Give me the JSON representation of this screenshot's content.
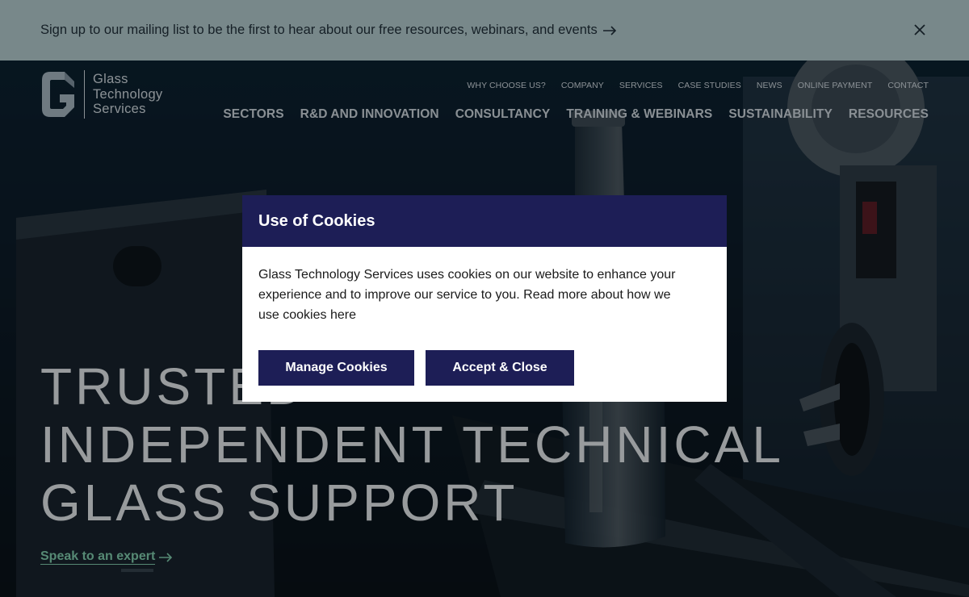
{
  "banner": {
    "text": "Sign up to our mailing list to be the first to hear about our free resources, webinars, and events",
    "arrow_icon": "arrow-right-icon",
    "close_icon": "close-icon"
  },
  "logo": {
    "lines": [
      "Glass",
      "Technology",
      "Services"
    ]
  },
  "utility_nav": [
    {
      "label": "WHY CHOOSE US?"
    },
    {
      "label": "COMPANY"
    },
    {
      "label": "SERVICES"
    },
    {
      "label": "CASE STUDIES"
    },
    {
      "label": "NEWS"
    },
    {
      "label": "ONLINE PAYMENT"
    },
    {
      "label": "CONTACT"
    }
  ],
  "main_nav": [
    {
      "label": "SECTORS"
    },
    {
      "label": "R&D AND INNOVATION"
    },
    {
      "label": "CONSULTANCY"
    },
    {
      "label": "TRAINING & WEBINARS"
    },
    {
      "label": "SUSTAINABILITY"
    },
    {
      "label": "RESOURCES"
    }
  ],
  "hero": {
    "headline_lines": [
      "TRUSTED",
      "INDEPENDENT TECHNICAL",
      "GLASS SUPPORT"
    ],
    "cta_label": "Speak to an expert"
  },
  "cookie_dialog": {
    "title": "Use of Cookies",
    "body": "Glass Technology Services uses cookies on our website to enhance your experience and to improve our service to you. Read more about how we use cookies here",
    "manage_label": "Manage Cookies",
    "accept_label": "Accept & Close"
  },
  "colors": {
    "banner_bg": "#c9dfde",
    "dialog_header": "#1d1e56",
    "button_bg": "#1d1e56",
    "cta_green": "#8de0b8"
  }
}
